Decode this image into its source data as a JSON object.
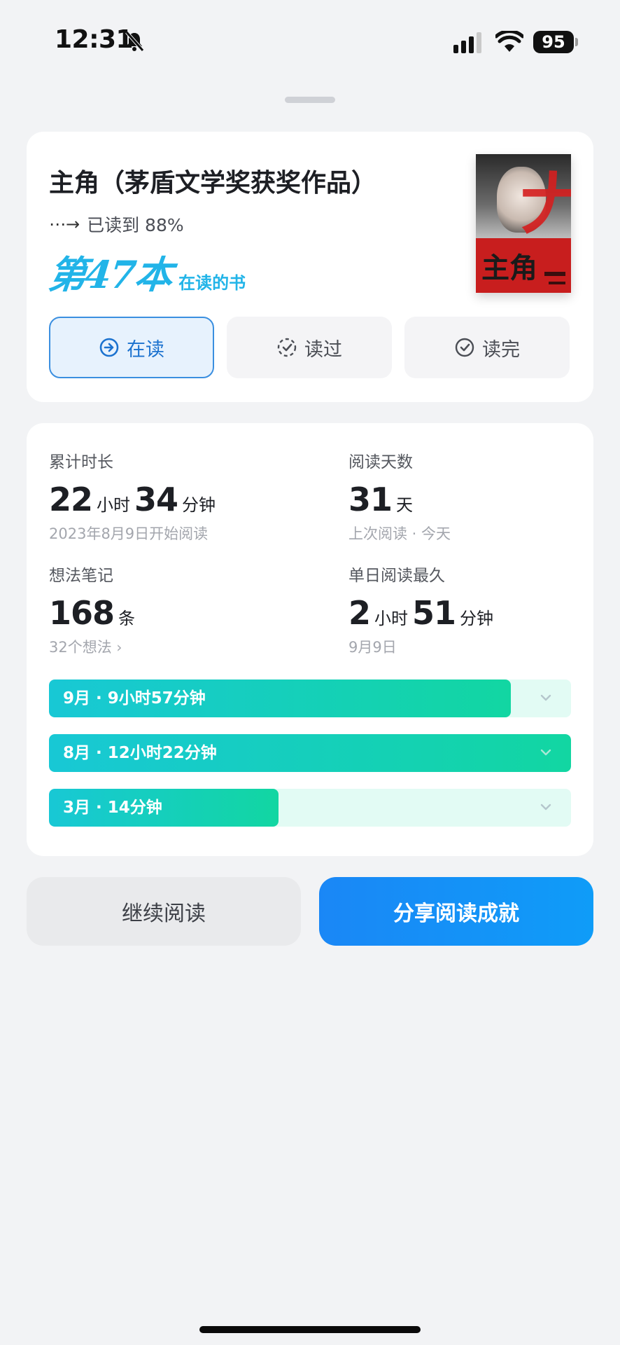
{
  "status_bar": {
    "time": "12:31",
    "battery": "95"
  },
  "book": {
    "title": "主角（茅盾文学奖获奖作品）",
    "progress_text": "已读到 88%",
    "rank_number": "第47本",
    "rank_suffix": "在读的书",
    "cover_title": "主角"
  },
  "status_buttons": [
    {
      "label": "在读",
      "active": true,
      "icon": "arrow-circle-icon"
    },
    {
      "label": "读过",
      "active": false,
      "icon": "dashed-check-circle-icon"
    },
    {
      "label": "读完",
      "active": false,
      "icon": "check-circle-icon"
    }
  ],
  "stats": {
    "total_time": {
      "label": "累计时长",
      "hours": "22",
      "hours_unit": "小时",
      "minutes": "34",
      "minutes_unit": "分钟",
      "sub": "2023年8月9日开始阅读"
    },
    "reading_days": {
      "label": "阅读天数",
      "value": "31",
      "unit": "天",
      "sub": "上次阅读 · 今天"
    },
    "notes": {
      "label": "想法笔记",
      "value": "168",
      "unit": "条",
      "sub": "32个想法"
    },
    "longest_day": {
      "label": "单日阅读最久",
      "hours": "2",
      "hours_unit": "小时",
      "minutes": "51",
      "minutes_unit": "分钟",
      "sub": "9月9日"
    }
  },
  "monthly": [
    {
      "label": "9月 · 9小时57分钟",
      "fill": 0.885
    },
    {
      "label": "8月 · 12小时22分钟",
      "fill": 1.0
    },
    {
      "label": "3月 · 14分钟",
      "fill": 0.44
    }
  ],
  "actions": {
    "continue": "继续阅读",
    "share": "分享阅读成就"
  },
  "colors": {
    "accent": "#1b72cf",
    "bar_start": "#18c8d5",
    "bar_end": "#12d6a2",
    "share": "#1a87f6",
    "rank": "#22b4e8"
  }
}
